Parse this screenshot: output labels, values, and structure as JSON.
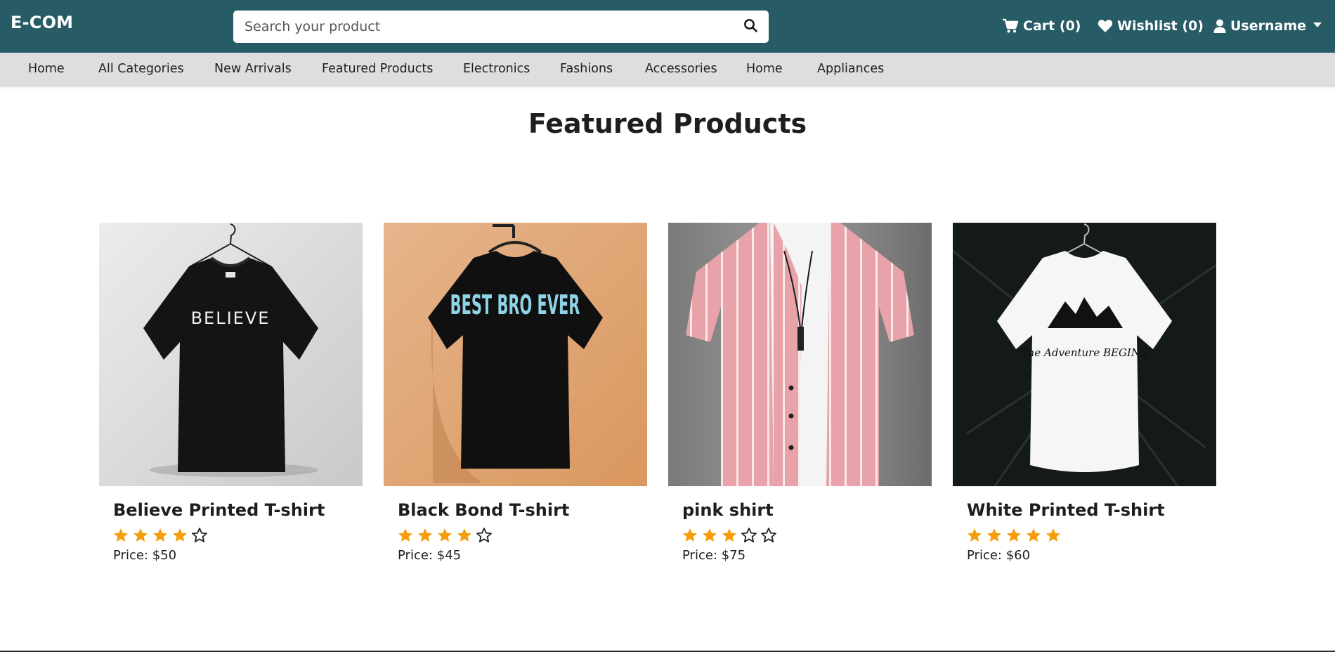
{
  "header": {
    "brand": "E-COM",
    "search": {
      "placeholder": "Search your product",
      "value": "",
      "icon": "search-icon"
    },
    "cart_label": "Cart (0)",
    "wishlist_label": "Wishlist (0)",
    "user_label": "Username",
    "colors": {
      "bar": "#275c66",
      "text": "#ffffff"
    }
  },
  "nav": {
    "items": [
      {
        "label": "Home"
      },
      {
        "label": "All Categories"
      },
      {
        "label": "New Arrivals"
      },
      {
        "label": "Featured Products"
      },
      {
        "label": "Electronics"
      },
      {
        "label": "Fashions"
      },
      {
        "label": "Accessories"
      },
      {
        "label": "Home"
      },
      {
        "label": "Appliances"
      }
    ]
  },
  "main": {
    "heading": "Featured Products",
    "products": [
      {
        "title": "Believe Printed T-shirt",
        "rating": 4,
        "price": "Price: $50"
      },
      {
        "title": "Black Bond T-shirt",
        "rating": 4,
        "price": "Price: $45"
      },
      {
        "title": "pink shirt",
        "rating": 3,
        "price": "Price: $75"
      },
      {
        "title": "White Printed T-shirt",
        "rating": 5,
        "price": "Price: $60"
      }
    ],
    "product_image_texts": [
      "BELIEVE",
      "BEST BRO EVER",
      "The Adventure BEGINS"
    ],
    "colors": {
      "star_filled": "#f59e0b",
      "star_empty": "#222222"
    }
  }
}
